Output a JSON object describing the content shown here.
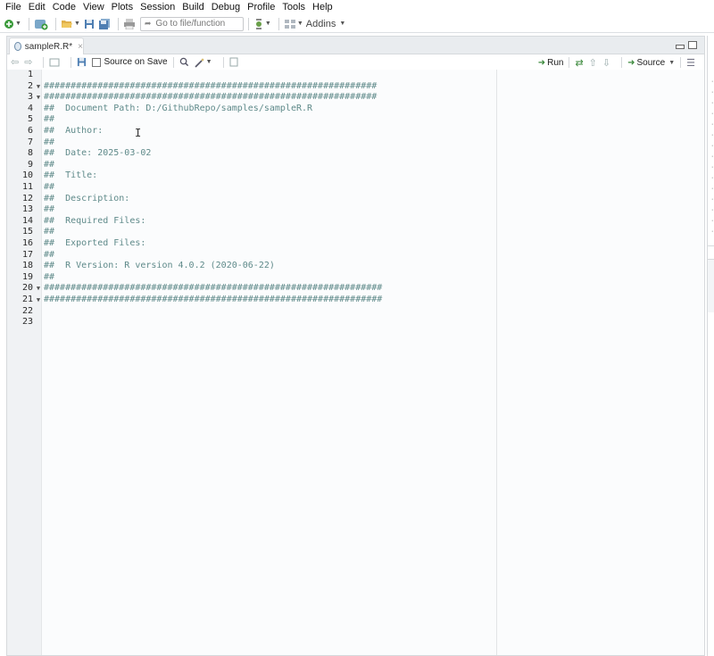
{
  "menu": [
    "File",
    "Edit",
    "Code",
    "View",
    "Plots",
    "Session",
    "Build",
    "Debug",
    "Profile",
    "Tools",
    "Help"
  ],
  "toolbar": {
    "goto_placeholder": "Go to file/function",
    "addins_label": "Addins"
  },
  "tab": {
    "filename": "sampleR.R*"
  },
  "editor_toolbar": {
    "source_on_save": "Source on Save",
    "run_label": "Run",
    "source_label": "Source"
  },
  "editor": {
    "lines": [
      {
        "n": "1",
        "fold": false,
        "text": ""
      },
      {
        "n": "2",
        "fold": true,
        "text": "##############################################################"
      },
      {
        "n": "3",
        "fold": true,
        "text": "##############################################################"
      },
      {
        "n": "4",
        "fold": false,
        "text": "##  Document Path: D:/GithubRepo/samples/sampleR.R"
      },
      {
        "n": "5",
        "fold": false,
        "text": "##"
      },
      {
        "n": "6",
        "fold": false,
        "text": "##  Author:"
      },
      {
        "n": "7",
        "fold": false,
        "text": "##"
      },
      {
        "n": "8",
        "fold": false,
        "text": "##  Date: 2025-03-02"
      },
      {
        "n": "9",
        "fold": false,
        "text": "##"
      },
      {
        "n": "10",
        "fold": false,
        "text": "##  Title:"
      },
      {
        "n": "11",
        "fold": false,
        "text": "##"
      },
      {
        "n": "12",
        "fold": false,
        "text": "##  Description:"
      },
      {
        "n": "13",
        "fold": false,
        "text": "##"
      },
      {
        "n": "14",
        "fold": false,
        "text": "##  Required Files:"
      },
      {
        "n": "15",
        "fold": false,
        "text": "##"
      },
      {
        "n": "16",
        "fold": false,
        "text": "##  Exported Files:"
      },
      {
        "n": "17",
        "fold": false,
        "text": "##"
      },
      {
        "n": "18",
        "fold": false,
        "text": "##  R Version: R version 4.0.2 (2020-06-22)"
      },
      {
        "n": "19",
        "fold": false,
        "text": "##"
      },
      {
        "n": "20",
        "fold": true,
        "text": "###############################################################"
      },
      {
        "n": "21",
        "fold": true,
        "text": "###############################################################"
      },
      {
        "n": "22",
        "fold": false,
        "text": ""
      },
      {
        "n": "23",
        "fold": false,
        "text": ""
      }
    ]
  }
}
